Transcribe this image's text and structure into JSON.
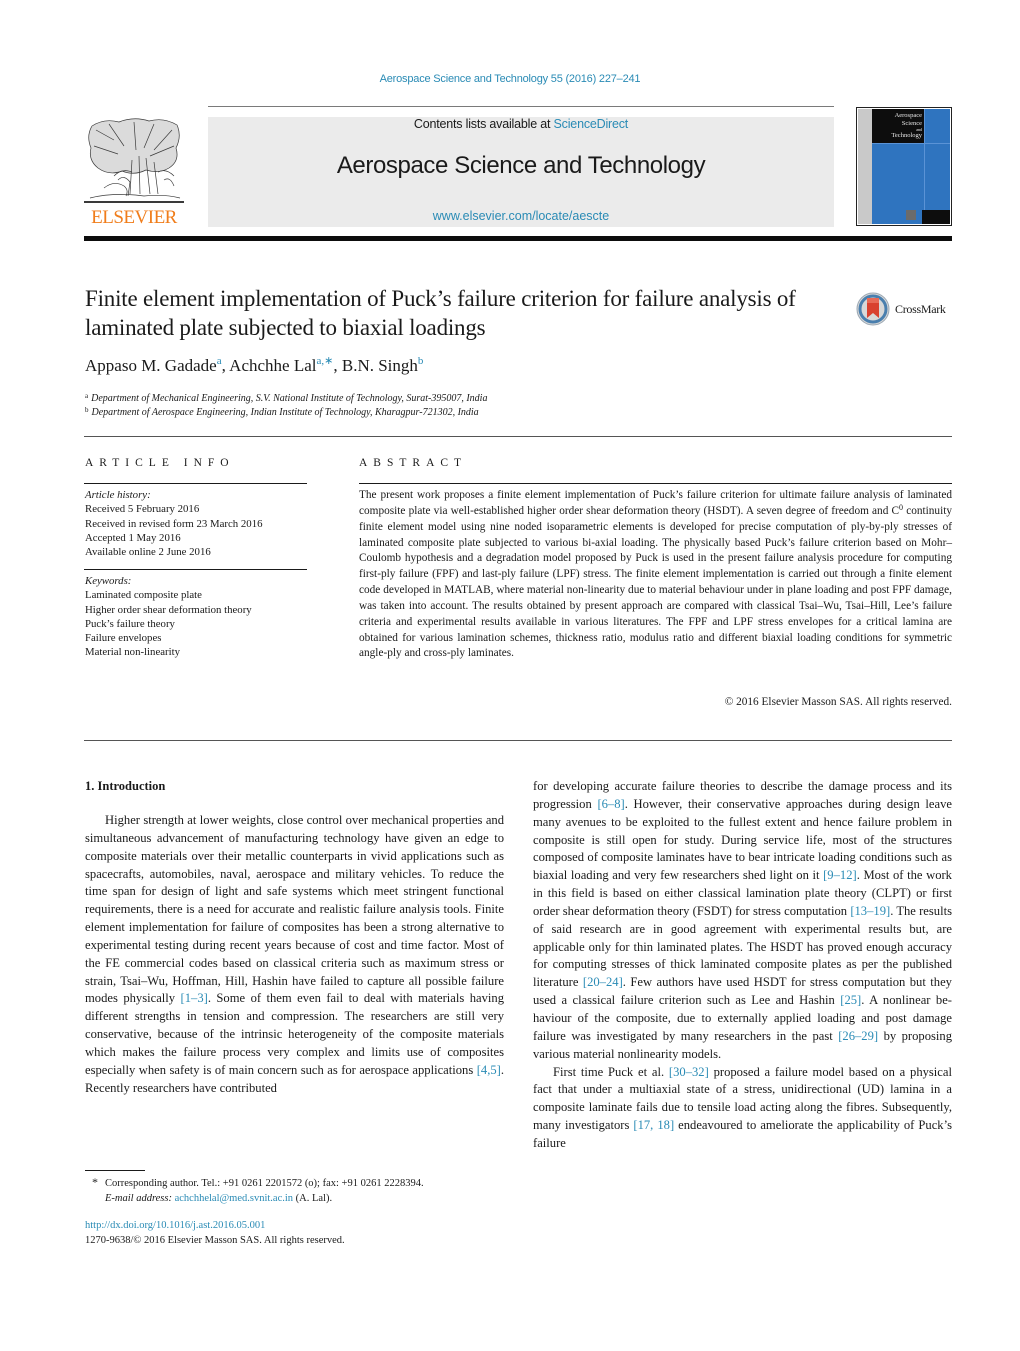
{
  "header": {
    "journal_reference": "Aerospace Science and Technology 55 (2016) 227–241",
    "contents_prefix": "Contents lists available at ",
    "contents_link": "ScienceDirect",
    "journal_title": "Aerospace Science and Technology",
    "journal_url": "www.elsevier.com/locate/aescte",
    "publisher_wordmark": "ELSEVIER",
    "cover_title_lines": [
      "Aerospace",
      "Science",
      "and",
      "Technology"
    ],
    "crossmark_label": "CrossMark"
  },
  "colors": {
    "link": "#2a8bb5",
    "elsevier_orange": "#f07d1b",
    "cover_blue": "#2f74bf",
    "masthead_gray": "#ebebeb"
  },
  "article": {
    "title": "Finite element implementation of Puck’s failure criterion for failure analysis of laminated plate subjected to biaxial loadings",
    "authors": [
      {
        "name": "Appaso M. Gadade",
        "marks": "a"
      },
      {
        "name": "Achchhe Lal",
        "marks": "a,∗"
      },
      {
        "name": "B.N. Singh",
        "marks": "b"
      }
    ],
    "affiliations": [
      {
        "mark": "a",
        "text": "Department of Mechanical Engineering, S.V. National Institute of Technology, Surat-395007, India"
      },
      {
        "mark": "b",
        "text": "Department of Aerospace Engineering, Indian Institute of Technology, Kharagpur-721302, India"
      }
    ]
  },
  "article_info": {
    "heading": "ARTICLE INFO",
    "history_label": "Article history:",
    "history": [
      "Received 5 February 2016",
      "Received in revised form 23 March 2016",
      "Accepted 1 May 2016",
      "Available online 2 June 2016"
    ],
    "keywords_label": "Keywords:",
    "keywords": [
      "Laminated composite plate",
      "Higher order shear deformation theory",
      "Puck’s failure theory",
      "Failure envelopes",
      "Material non-linearity"
    ]
  },
  "abstract": {
    "heading": "ABSTRACT",
    "part1": "The present work proposes a finite element implementation of Puck’s failure criterion for ultimate failure analysis of laminated composite plate via well-established higher order shear deformation theory (HSDT). A seven degree of freedom and C",
    "sup": "0",
    "part2": " continuity finite element model using nine noded isoparametric elements is developed for precise computation of ply-by-ply stresses of laminated composite plate subjected to various bi-axial loading. The physically based Puck’s failure criterion based on Mohr–Coulomb hypothesis and a degradation model proposed by Puck is used in the present failure analysis procedure for computing first-ply failure (FPF) and last-ply failure (LPF) stress. The finite element implementation is carried out through a finite element code developed in MATLAB, where material non-linearity due to material behaviour under in plane loading and post FPF damage, was taken into account. The results obtained by present approach are compared with classical Tsai–Wu, Tsai–Hill, Lee’s failure criteria and experimental results available in various literatures. The FPF and LPF stress envelopes for a critical lamina are obtained for various lamination schemes, thickness ratio, modulus ratio and different biaxial loading conditions for symmetric angle-ply and cross-ply laminates.",
    "copyright": "© 2016 Elsevier Masson SAS. All rights reserved."
  },
  "body": {
    "section_heading": "1. Introduction",
    "left_col": [
      {
        "t": "Higher strength at lower weights, close control over mechan­ical properties and simultaneous advancement of manufacturing technology have given an edge to composite materials over their metallic counterparts in vivid applications such as spacecrafts, au­tomobiles, naval, aerospace and military vehicles. To reduce the time span for design of light and safe systems which meet strin­gent functional requirements, there is a need for accurate and realistic failure analysis tools. Finite element implementation for failure of composites has been a strong alternative to experimental testing during recent years because of cost and time factor. Most of the FE commercial codes based on classical criteria such as maxi­mum stress or strain, Tsai–Wu, Hoffman, Hill, Hashin have failed to capture all possible failure modes physically "
      },
      {
        "ref": "[1–3]"
      },
      {
        "t": ". Some of them even fail to deal with materials having different strengths in ten­sion and compression. The researchers are still very conservative, because of the intrinsic heterogeneity of the composite materials which makes the failure process very complex and limits use of composites especially when safety is of main concern such as for aerospace applications "
      },
      {
        "ref": "[4,5]"
      },
      {
        "t": ". Recently researchers have contributed"
      }
    ],
    "right_col_p1": [
      {
        "t": "for developing accurate failure theories to describe the damage process and its progression "
      },
      {
        "ref": "[6–8]"
      },
      {
        "t": ". However, their conservative ap­proaches during design leave many avenues to be exploited to the fullest extent and hence failure problem in composite is still open for study. During service life, most of the structures composed of composite laminates have to bear intricate loading conditions such as biaxial loading and very few researchers shed light on it "
      },
      {
        "ref": "[9–12]"
      },
      {
        "t": ". Most of the work in this field is based on either classi­cal lamination plate theory (CLPT) or first order shear deformation theory (FSDT) for stress computation "
      },
      {
        "ref": "[13–19]"
      },
      {
        "t": ". The results of said research are in good agreement with experimental results but, are applicable only for thin laminated plates. The HSDT has proved enough accuracy for computing stresses of thick laminated com­posite plates as per the published literature "
      },
      {
        "ref": "[20–24]"
      },
      {
        "t": ". Few authors have used HSDT for stress computation but they used a classical failure criterion such as Lee and Hashin "
      },
      {
        "ref": "[25]"
      },
      {
        "t": ". A nonlinear be­haviour of the composite, due to externally applied loading and post damage failure was investigated by many researchers in the past "
      },
      {
        "ref": "[26–29]"
      },
      {
        "t": " by proposing various material nonlinearity models."
      }
    ],
    "right_col_p2": [
      {
        "t": "First time Puck et al. "
      },
      {
        "ref": "[30–32]"
      },
      {
        "t": " proposed a failure model based on a physical fact that under a multiaxial state of a stress, unidi­rectional (UD) lamina in a composite laminate fails due to tensile load acting along the fibres. Subsequently, many investigators "
      },
      {
        "ref": "[17, 18]"
      },
      {
        "t": " endeavoured to ameliorate the applicability of Puck’s failure"
      }
    ]
  },
  "footnote": {
    "star": "*",
    "corresponding": "Corresponding author. Tel.: +91 0261 2201572 (o); fax: +91 0261 2228394.",
    "email_label": "E-mail address:",
    "email": "achchhelal@med.svnit.ac.in",
    "email_suffix": " (A. Lal).",
    "doi": "http://dx.doi.org/10.1016/j.ast.2016.05.001",
    "issn_line": "1270-9638/© 2016 Elsevier Masson SAS. All rights reserved."
  }
}
